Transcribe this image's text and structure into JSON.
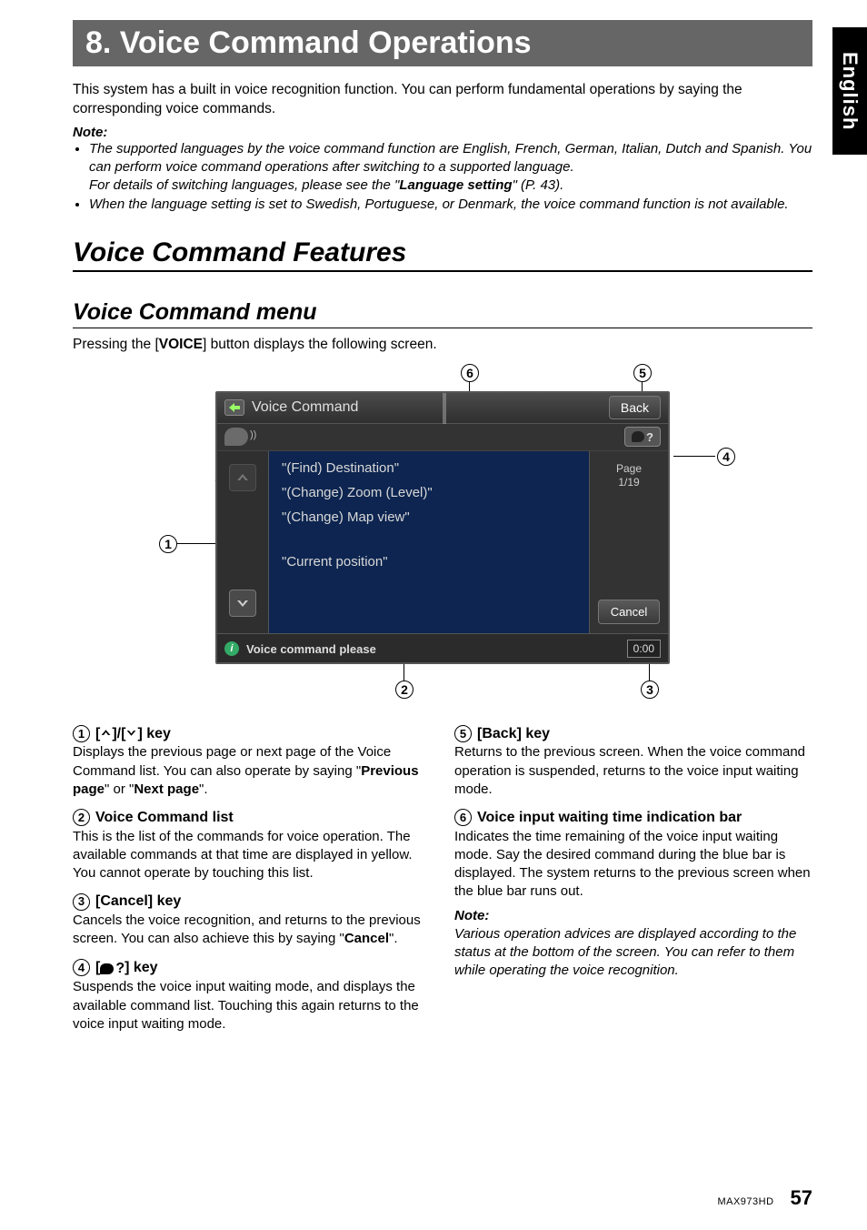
{
  "side_tab": "English",
  "chapter_title": "8.   Voice Command Operations",
  "intro": "This system has a built in voice recognition function. You can perform fundamental operations by saying the corresponding voice commands.",
  "note_label": "Note:",
  "notes": [
    {
      "pre": "The supported languages by the voice command function are English, French, German, Italian, Dutch and Spanish. You can perform voice command operations after switching to a supported language.\nFor details of switching languages, please see the \"",
      "bold": "Language setting",
      "post": "\" (P. 43)."
    },
    {
      "pre": "When the language setting is set to Swedish, Portuguese, or Denmark, the voice command function is not available.",
      "bold": "",
      "post": ""
    }
  ],
  "section_title": "Voice Command Features",
  "subhead": "Voice Command menu",
  "subhead_intro_pre": "Pressing the [",
  "subhead_intro_bold": "VOICE",
  "subhead_intro_post": "] button displays the following screen.",
  "screenshot": {
    "window_title": "Voice Command",
    "back_label": "Back",
    "page_label": "Page",
    "page_value": "1/19",
    "cancel_label": "Cancel",
    "commands": [
      "\"(Find) Destination\"",
      "\"(Change) Zoom (Level)\"",
      "\"(Change) Map view\"",
      "\"Current position\""
    ],
    "footer_hint": "Voice command please",
    "timer": "0:00"
  },
  "callout_labels": {
    "1": "1",
    "2": "2",
    "3": "3",
    "4": "4",
    "5": "5",
    "6": "6"
  },
  "left_col": {
    "i1": {
      "title_suffix": "] key",
      "body_pre": "Displays the previous page or next page of the Voice Command list. You can also operate by saying \"",
      "b1": "Previous  page",
      "mid": "\" or \"",
      "b2": "Next  page",
      "post": "\"."
    },
    "i2": {
      "title": "Voice Command list",
      "body": "This is the list of the commands for voice operation. The available commands at that time are displayed in yellow. You cannot operate by touching this list."
    },
    "i3": {
      "title": "[Cancel] key",
      "body_pre": "Cancels the voice recognition, and returns to the previous screen. You can also achieve this by saying \"",
      "b1": "Cancel",
      "post": "\"."
    },
    "i4": {
      "title_suffix": "] key",
      "body": "Suspends the voice input waiting mode, and displays the available command list. Touching this again returns to the voice input waiting mode."
    }
  },
  "right_col": {
    "i5": {
      "title": "[Back] key",
      "body": "Returns to the previous screen. When the voice command operation is suspended, returns to the voice input waiting mode."
    },
    "i6": {
      "title": "Voice input waiting time indication bar",
      "body": "Indicates the time remaining of the voice input waiting mode. Say the desired command during the blue bar is displayed. The system returns to the previous screen when the blue bar runs out."
    },
    "note_head": "Note:",
    "note_body": "Various operation advices are displayed according to the status at the bottom of the screen. You can refer to them while operating the voice recognition."
  },
  "footer": {
    "model": "MAX973HD",
    "page": "57"
  }
}
